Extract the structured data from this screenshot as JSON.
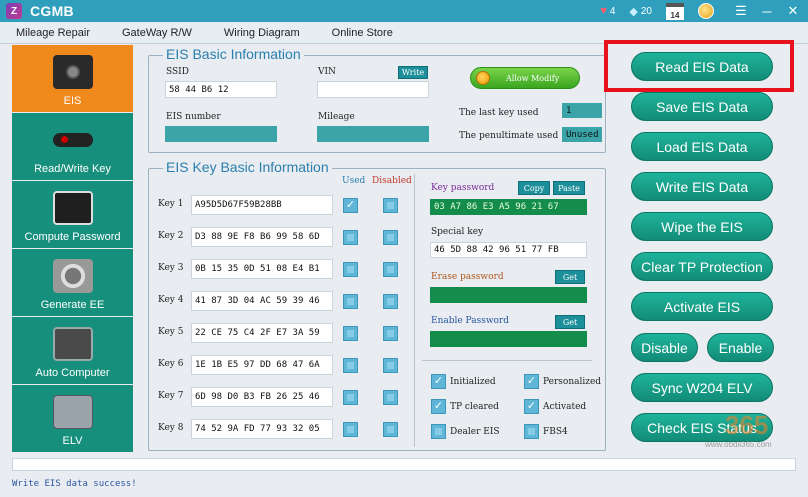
{
  "window": {
    "title": "CGMB",
    "logo_letter": "Z",
    "stats": [
      {
        "icon": "heart-icon",
        "glyph": "♥",
        "value": "4"
      },
      {
        "icon": "diamond-icon",
        "glyph": "◆",
        "value": "20"
      }
    ],
    "calendar_day": "14",
    "menu_glyph": "☰",
    "minimize_glyph": "─",
    "close_glyph": "✕"
  },
  "menu": [
    "Mileage Repair",
    "GateWay R/W",
    "Wiring Diagram",
    "Online Store"
  ],
  "sidebar": [
    {
      "label": "EIS",
      "icon": "ignition-switch-icon",
      "active": true
    },
    {
      "label": "Read/Write Key",
      "icon": "car-key-icon"
    },
    {
      "label": "Compute Password",
      "icon": "monitor-icon"
    },
    {
      "label": "Generate EE",
      "icon": "generator-icon"
    },
    {
      "label": "Auto Computer",
      "icon": "ecu-icon"
    },
    {
      "label": "ELV",
      "icon": "steering-lock-icon"
    }
  ],
  "basic": {
    "title": "EIS Basic Information",
    "ssid_label": "SSID",
    "ssid_value": "58 44 B6 12",
    "vin_label": "VIN",
    "vin_value": "",
    "write_label": "Write",
    "eis_number_label": "EIS number",
    "eis_number_value": "",
    "mileage_label": "Mileage",
    "mileage_value": "",
    "allow_modify_label": "Allow Modify",
    "last_key_label": "The last key used",
    "last_key_value": "1",
    "penultimate_label": "The penultimate used",
    "penultimate_value": "Unused"
  },
  "keys": {
    "title": "EIS Key Basic Information",
    "used_header": "Used",
    "disabled_header": "Disabled",
    "rows": [
      {
        "label": "Key 1",
        "value": "A95D5D67F59B28BB",
        "used": true
      },
      {
        "label": "Key 2",
        "value": "D3 88 9E F8 B6 99 58 6D",
        "used": false
      },
      {
        "label": "Key 3",
        "value": "0B 15 35 0D 51 08 E4 B1",
        "used": false
      },
      {
        "label": "Key 4",
        "value": "41 87 3D 04 AC 59 39 46",
        "used": false
      },
      {
        "label": "Key 5",
        "value": "22 CE 75 C4 2F E7 3A 59",
        "used": false
      },
      {
        "label": "Key 6",
        "value": "1E 1B E5 97 DD 68 47 6A",
        "used": false
      },
      {
        "label": "Key 7",
        "value": "6D 98 D0 B3 FB 26 25 46",
        "used": false
      },
      {
        "label": "Key 8",
        "value": "74 52 9A FD 77 93 32 05",
        "used": false
      }
    ],
    "key_password_label": "Key password",
    "key_password_value": "03 A7 86 E3 A5 96 21 67",
    "copy_label": "Copy",
    "paste_label": "Paste",
    "special_key_label": "Special key",
    "special_key_value": "46 5D 88 42 96 51 77 FB",
    "erase_password_label": "Erase password",
    "erase_password_value": "",
    "enable_password_label": "Enable Password",
    "enable_password_value": "",
    "get_label": "Get",
    "status_checks": [
      {
        "label": "Initialized",
        "checked": true
      },
      {
        "label": "Personalized",
        "checked": true
      },
      {
        "label": "TP cleared",
        "checked": true
      },
      {
        "label": "Activated",
        "checked": true
      },
      {
        "label": "Dealer EIS",
        "checked": false
      },
      {
        "label": "FBS4",
        "checked": false
      }
    ]
  },
  "actions": {
    "read": "Read  EIS Data",
    "save": "Save EIS Data",
    "load": "Load EIS Data",
    "write": "Write EIS Data",
    "wipe": "Wipe the EIS",
    "clear_tp": "Clear TP Protection",
    "activate": "Activate EIS",
    "disable": "Disable",
    "enable": "Enable",
    "sync": "Sync W204 ELV",
    "check": "Check EIS Status"
  },
  "status_text": "Write EIS data success!",
  "watermark": {
    "main": "365",
    "sub": "www.obdii365.com"
  },
  "colors": {
    "accent": "#168f7d",
    "active": "#f0891b",
    "highlight": "#e8121c",
    "titlebar": "#2f9fbd"
  }
}
